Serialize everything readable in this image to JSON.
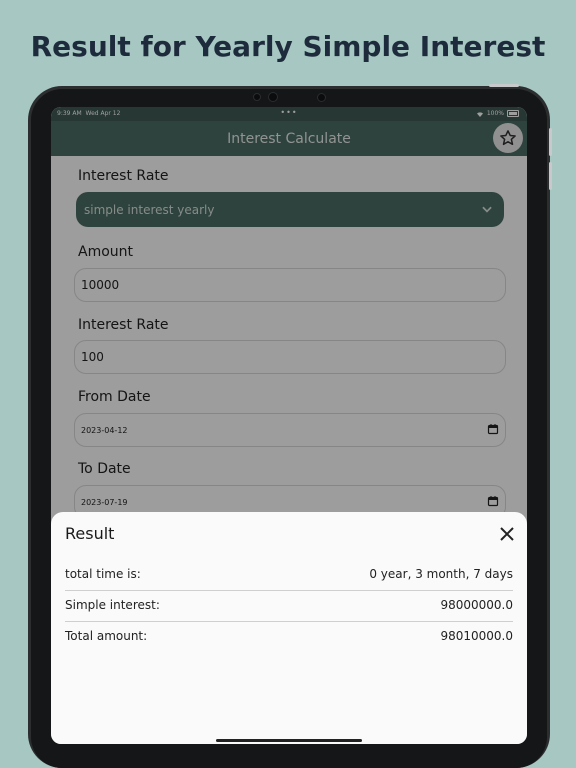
{
  "headline": "Result for Yearly Simple Interest",
  "status_bar": {
    "time": "9:39 AM",
    "date": "Wed Apr 12",
    "dots": "•••",
    "battery": "100%"
  },
  "app_bar": {
    "title": "Interest Calculate",
    "favorite_icon": "star-outline"
  },
  "form": {
    "interest_type_label": "Interest Rate",
    "interest_type_value": "simple interest yearly",
    "amount_label": "Amount",
    "amount_value": "10000",
    "rate_label": "Interest Rate",
    "rate_value": "100",
    "from_date_label": "From Date",
    "from_date_value": "2023-04-12",
    "to_date_label": "To Date",
    "to_date_value": "2023-07-19"
  },
  "result": {
    "title": "Result",
    "rows": [
      {
        "label": "total time is:",
        "value": "0 year, 3 month, 7 days"
      },
      {
        "label": "Simple interest:",
        "value": "98000000.0"
      },
      {
        "label": "Total amount:",
        "value": "98010000.0"
      }
    ]
  },
  "colors": {
    "background": "#a7c8c2",
    "app_bar": "#4b6c63",
    "headline": "#1e2b3c"
  }
}
